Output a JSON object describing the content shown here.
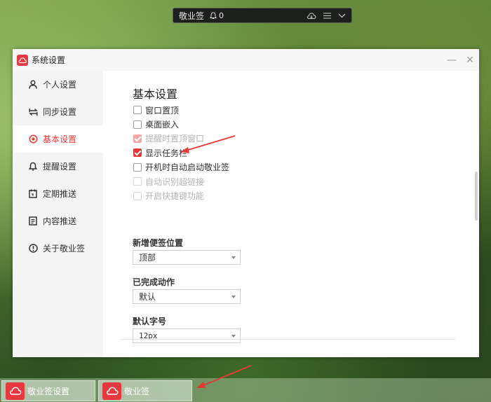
{
  "notebar": {
    "title": "敬业签",
    "count": "0"
  },
  "window": {
    "title": "系统设置",
    "minimize_glyph": "—",
    "close_glyph": "✕"
  },
  "sidebar": {
    "items": [
      {
        "label": "个人设置",
        "icon": "user-icon"
      },
      {
        "label": "同步设置",
        "icon": "sync-icon"
      },
      {
        "label": "基本设置",
        "icon": "basic-settings-icon",
        "active": true
      },
      {
        "label": "提醒设置",
        "icon": "bell-icon"
      },
      {
        "label": "定期推送",
        "icon": "calendar-icon"
      },
      {
        "label": "内容推送",
        "icon": "document-icon"
      },
      {
        "label": "关于敬业签",
        "icon": "info-icon"
      }
    ]
  },
  "main": {
    "section_title": "基本设置",
    "checkboxes": [
      {
        "label": "窗口置顶",
        "checked": false,
        "disabled": false
      },
      {
        "label": "桌面嵌入",
        "checked": false,
        "disabled": false
      },
      {
        "label": "提醒时置顶窗口",
        "checked": true,
        "disabled": true
      },
      {
        "label": "显示任务栏",
        "checked": true,
        "disabled": false
      },
      {
        "label": "开机时自动启动敬业签",
        "checked": false,
        "disabled": false
      },
      {
        "label": "自动识别超链接",
        "checked": false,
        "disabled": true
      },
      {
        "label": "开启快捷键功能",
        "checked": false,
        "disabled": true
      }
    ],
    "new_note_position": {
      "label": "新增便签位置",
      "value": "顶部"
    },
    "completed_action": {
      "label": "已完成动作",
      "value": "默认"
    },
    "default_font_size": {
      "label": "默认字号",
      "value": "12px"
    }
  },
  "taskbar": {
    "items": [
      {
        "label": "敬业签设置"
      },
      {
        "label": "敬业签"
      }
    ]
  },
  "colors": {
    "accent": "#e53935",
    "annotation": "#e53935"
  }
}
